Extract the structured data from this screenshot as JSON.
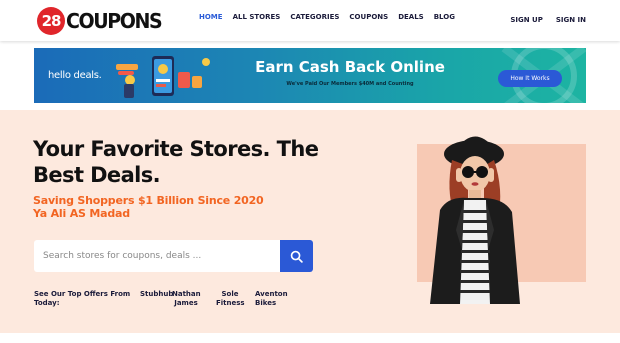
{
  "header": {
    "logo": {
      "number": "28",
      "text": "COUPONS"
    },
    "nav": [
      {
        "label": "HOME",
        "active": true
      },
      {
        "label": "ALL STORES",
        "active": false
      },
      {
        "label": "CATEGORIES",
        "active": false
      },
      {
        "label": "COUPONS",
        "active": false
      },
      {
        "label": "DEALS",
        "active": false
      },
      {
        "label": "BLOG",
        "active": false
      }
    ],
    "sign_up": "SIGN UP",
    "sign_in": "SIGN IN"
  },
  "banner": {
    "brand": "hello deals.",
    "title": "Earn Cash Back Online",
    "subtitle": "We've Paid Our Members $40M and Counting",
    "button": "How It Works"
  },
  "hero": {
    "headline": "Your Favorite Stores. The Best Deals.",
    "tagline_line1": "Saving Shoppers $1 Billion Since 2020",
    "tagline_line2": "Ya Ali AS Madad",
    "search_placeholder": "Search stores for coupons, deals ...",
    "offers_label": "See Our Top Offers From Today:",
    "offers": [
      "Stubhub",
      "Nathan James",
      "Sole Fitness",
      "Aventon Bikes"
    ]
  },
  "colors": {
    "accent": "#2b59d6",
    "brand_red": "#e0262b",
    "tagline_orange": "#f26522",
    "hero_bg": "#fde9de"
  }
}
